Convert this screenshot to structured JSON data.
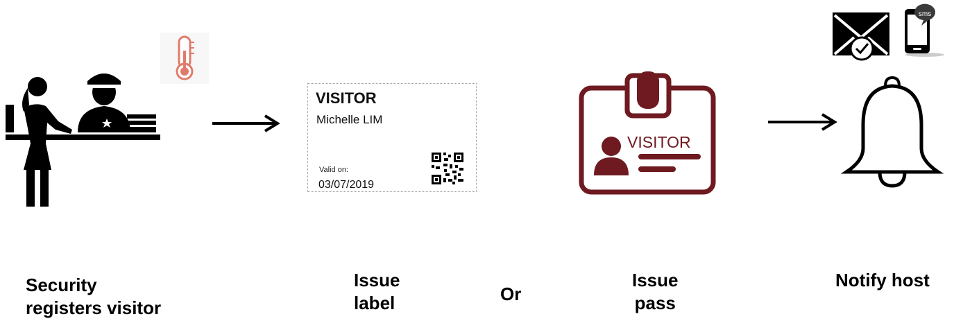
{
  "steps": [
    {
      "caption": "Security\nregisters visitor"
    },
    {
      "caption": "Issue\nlabel"
    },
    {
      "caption": "Issue\npass"
    },
    {
      "caption": "Notify host"
    }
  ],
  "or_label": "Or",
  "visitor_label": {
    "title": "VISITOR",
    "name": "Michelle LIM",
    "valid_label": "Valid on:",
    "date": "03/07/2019"
  },
  "visitor_pass": {
    "text": "VISITOR"
  },
  "sms_badge": "sms",
  "colors": {
    "pass": "#6e1a20",
    "thermometer": "#e07b6a",
    "black": "#000000"
  }
}
